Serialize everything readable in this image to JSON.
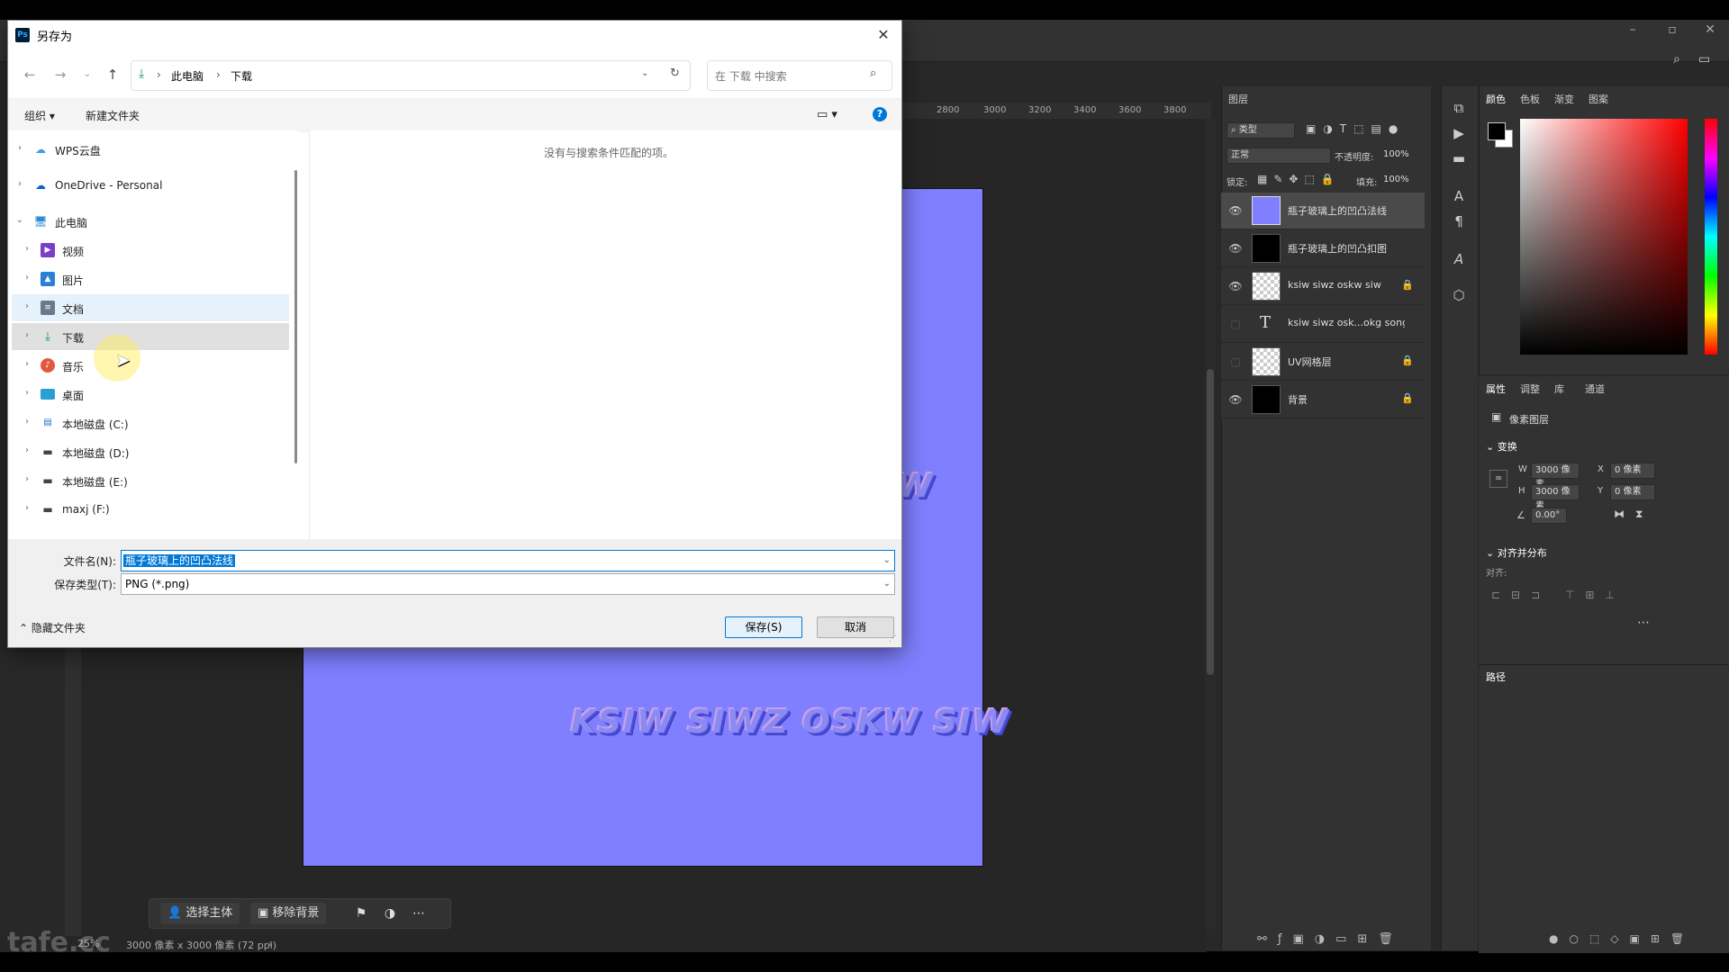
{
  "dialog": {
    "title": "另存为",
    "app_icon": "Ps",
    "address": {
      "crumbs": [
        "此电脑",
        "下载"
      ]
    },
    "search_placeholder": "在 下载 中搜索",
    "toolbar": {
      "organize": "组织 ▾",
      "new_folder": "新建文件夹"
    },
    "nav_items": [
      {
        "label": "WPS云盘",
        "icon": "cloud-icon",
        "color": "#3aa0e8"
      },
      {
        "label": "OneDrive - Personal",
        "icon": "onedrive-icon",
        "color": "#0a64c8"
      },
      {
        "label": "此电脑",
        "icon": "pc-icon",
        "color": "#2a8bd6"
      },
      {
        "label": "视频",
        "icon": "video-icon",
        "color": "#7a3fc8"
      },
      {
        "label": "图片",
        "icon": "picture-icon",
        "color": "#2a7fd6"
      },
      {
        "label": "文档",
        "icon": "document-icon",
        "color": "#6a7a8a"
      },
      {
        "label": "下载",
        "icon": "download-icon",
        "color": "#1e9b5e"
      },
      {
        "label": "音乐",
        "icon": "music-icon",
        "color": "#e05a3a"
      },
      {
        "label": "桌面",
        "icon": "desktop-icon",
        "color": "#2a9fd6"
      },
      {
        "label": "本地磁盘 (C:)",
        "icon": "drive-c-icon",
        "color": "#444444"
      },
      {
        "label": "本地磁盘 (D:)",
        "icon": "drive-icon",
        "color": "#444444"
      },
      {
        "label": "本地磁盘 (E:)",
        "icon": "drive-icon",
        "color": "#444444"
      },
      {
        "label": "maxj (F:)",
        "icon": "drive-icon",
        "color": "#444444"
      }
    ],
    "empty_message": "没有与搜索条件匹配的项。",
    "filename_label": "文件名(N):",
    "filename_value": "瓶子玻璃上的凹凸法线",
    "filetype_label": "保存类型(T):",
    "filetype_value": "PNG (*.png)",
    "hide_folders": "隐藏文件夹",
    "save_button": "保存(S)",
    "cancel_button": "取消"
  },
  "canvas": {
    "text": "KSIW  SIWZ OSKW  SIW",
    "side_text": "W",
    "color": "#7f7fff"
  },
  "ruler_ticks": [
    "2800",
    "3000",
    "3200",
    "3400",
    "3600",
    "3800"
  ],
  "status": {
    "zoom": "25%",
    "doc_info": "3000 像素 x 3000 像素 (72 ppi)"
  },
  "context_bar": {
    "select_subject": "选择主体",
    "remove_background": "移除背景"
  },
  "layers_panel": {
    "tab": "图层",
    "filter": "类型",
    "blend_mode": "正常",
    "opacity_label": "不透明度:",
    "opacity_value": "100%",
    "lock_label": "锁定:",
    "fill_label": "填充:",
    "fill_value": "100%",
    "layers": [
      {
        "name": "瓶子玻璃上的凹凸法线",
        "visible": true,
        "thumb": "blue",
        "locked": false,
        "selected": true
      },
      {
        "name": "瓶子玻璃上的凹凸扣图",
        "visible": true,
        "thumb": "black-mask",
        "locked": false,
        "selected": false
      },
      {
        "name": "ksiw  siwz oskw  siw",
        "visible": true,
        "thumb": "checker",
        "locked": true,
        "selected": false
      },
      {
        "name": "ksiw  siwz osk...okg songls wi",
        "visible": false,
        "thumb": "text",
        "locked": false,
        "selected": false
      },
      {
        "name": "UV网格层",
        "visible": false,
        "thumb": "checker",
        "locked": true,
        "selected": false
      },
      {
        "name": "背景",
        "visible": true,
        "thumb": "black",
        "locked": true,
        "selected": false
      }
    ]
  },
  "color_panel": {
    "tabs": [
      "颜色",
      "色板",
      "渐变",
      "图案"
    ]
  },
  "properties_panel": {
    "tabs": [
      "属性",
      "调整",
      "库",
      "通道"
    ],
    "layer_type": "像素图层",
    "transform_label": "变换",
    "w_label": "W",
    "w_value": "3000 像素",
    "h_label": "H",
    "h_value": "3000 像素",
    "x_label": "X",
    "x_value": "0 像素",
    "y_label": "Y",
    "y_value": "0 像素",
    "angle_value": "0.00°",
    "align_label": "对齐并分布",
    "align_sub": "对齐:"
  },
  "paths_panel": {
    "tab": "路径"
  },
  "watermark": "tafe.cc"
}
